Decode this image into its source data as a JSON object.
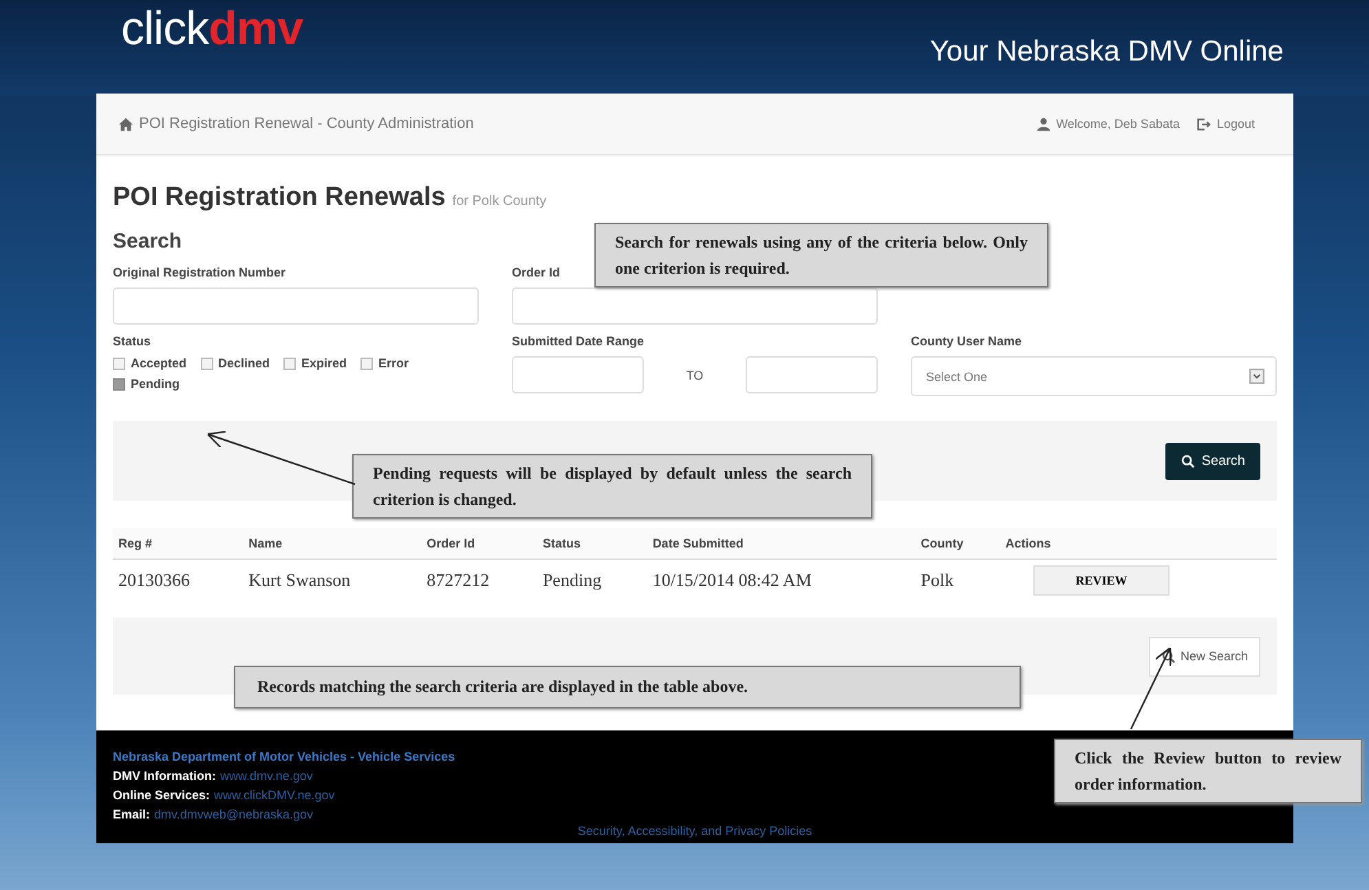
{
  "header": {
    "logo_part1": "click",
    "logo_part2": "dmv",
    "tagline": "Your Nebraska DMV Online"
  },
  "breadcrumb": {
    "text": "POI Registration Renewal - County Administration",
    "welcome": "Welcome, Deb Sabata",
    "logout": "Logout"
  },
  "page_title": "POI Registration Renewals",
  "page_subtitle": "for Polk County",
  "search": {
    "heading": "Search",
    "registration_label": "Original Registration Number",
    "order_label": "Order Id",
    "status_label": "Status",
    "statuses": [
      {
        "label": "Accepted",
        "checked": false
      },
      {
        "label": "Declined",
        "checked": false
      },
      {
        "label": "Expired",
        "checked": false
      },
      {
        "label": "Error",
        "checked": false
      },
      {
        "label": "Pending",
        "checked": true
      }
    ],
    "date_label": "Submitted Date Range",
    "date_separator": "TO",
    "user_label": "County User Name",
    "user_placeholder": "Select One",
    "search_button": "Search"
  },
  "table": {
    "columns": [
      "Reg #",
      "Name",
      "Order Id",
      "Status",
      "Date Submitted",
      "County",
      "Actions"
    ],
    "rows": [
      {
        "cells": [
          "20130366",
          "Kurt Swanson",
          "8727212",
          "Pending",
          "10/15/2014 08:42 AM",
          "Polk"
        ],
        "action": "REVIEW"
      }
    ]
  },
  "new_search_button": "New Search",
  "footer": {
    "title": "Nebraska Department of Motor Vehicles - Vehicle Services",
    "lines": [
      {
        "label": "DMV Information:",
        "link": "www.dmv.ne.gov"
      },
      {
        "label": "Online Services:",
        "link": "www.clickDMV.ne.gov"
      },
      {
        "label": "Email:",
        "link": "dmv.dmvweb@nebraska.gov"
      }
    ],
    "policies": "Security, Accessibility, and Privacy Policies"
  },
  "callouts": [
    {
      "text": "Search for renewals using any of the criteria below. Only one criterion is required."
    },
    {
      "text": "Pending requests will be displayed by default unless the search criterion is changed."
    },
    {
      "text": "Records matching the search criteria are displayed in the table above."
    },
    {
      "text": "Click the Review button to review order information."
    }
  ]
}
